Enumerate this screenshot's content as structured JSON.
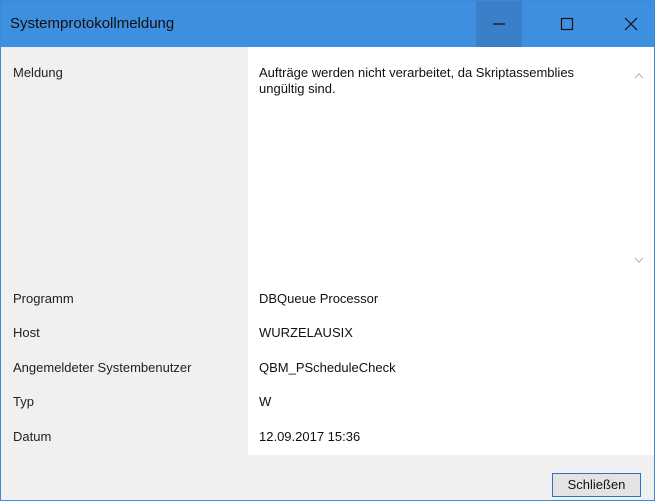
{
  "window": {
    "title": "Systemprotokollmeldung",
    "accent_color": "#3f8fe0"
  },
  "fields": {
    "meldung_label": "Meldung",
    "meldung_value": "Aufträge werden nicht verarbeitet, da Skriptassemblies ungültig sind.",
    "programm_label": "Programm",
    "programm_value": "DBQueue Processor",
    "host_label": "Host",
    "host_value": "WURZELAUSIX",
    "benutzer_label": "Angemeldeter Systembenutzer",
    "benutzer_value": "QBM_PScheduleCheck",
    "typ_label": "Typ",
    "typ_value": "W",
    "datum_label": "Datum",
    "datum_value": "12.09.2017 15:36"
  },
  "footer": {
    "close_label": "Schließen"
  },
  "icons": {
    "minimize": "minimize-icon",
    "maximize": "maximize-icon",
    "close": "close-icon",
    "scroll_up": "chevron-up-icon",
    "scroll_down": "chevron-down-icon"
  }
}
